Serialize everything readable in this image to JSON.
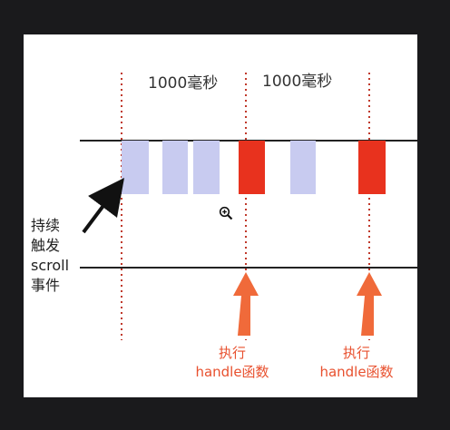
{
  "labels": {
    "interval_1": "1000毫秒",
    "interval_2": "1000毫秒",
    "trigger": "持续\n触发\nscroll\n事件",
    "exec_1": "执行\nhandle函数",
    "exec_2": "执行\nhandle函数"
  },
  "icons": {
    "pointer": "zoom-in-icon"
  },
  "colors": {
    "event_block": "#c8cbf0",
    "handler_block": "#e8321e",
    "divider": "#c0392b",
    "arrow_up": "#f06a3a",
    "line": "#222222"
  }
}
